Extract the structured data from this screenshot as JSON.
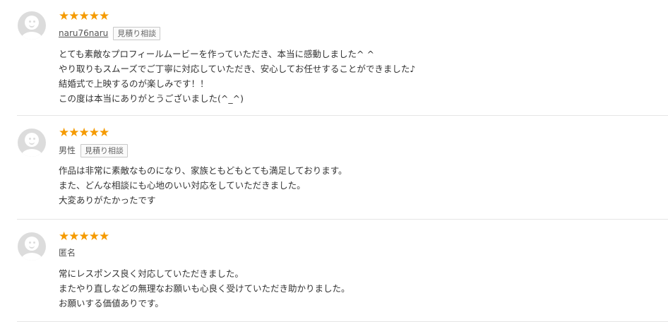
{
  "reviews": [
    {
      "rating": 5,
      "stars": "★★★★★",
      "user": "naru76naru",
      "tag": "見積り相談",
      "lines": [
        "とても素敵なプロフィールムービーを作っていただき、本当に感動しました^ ^",
        "やり取りもスムーズでご丁寧に対応していただき、安心してお任せすることができました♪",
        "結婚式で上映するのが楽しみです！！",
        "この度は本当にありがとうございました(^_^)"
      ]
    },
    {
      "rating": 5,
      "stars": "★★★★★",
      "user": "男性",
      "tag": "見積り相談",
      "lines": [
        "作品は非常に素敵なものになり、家族ともどもとても満足しております。",
        "また、どんな相談にも心地のいい対応をしていただきました。",
        "大変ありがたかったです"
      ]
    },
    {
      "rating": 5,
      "stars": "★★★★★",
      "user": "匿名",
      "lines": [
        "常にレスポンス良く対応していただきました。",
        "またやり直しなどの無理なお願いも心良く受けていただき助かりました。",
        "お願いする価値ありです。"
      ]
    }
  ],
  "icons": {
    "avatar": "default-user-avatar-icon",
    "star": "star-icon"
  },
  "colors": {
    "star": "#f59a00",
    "avatar_bg": "#dcdcdc",
    "divider": "#e5e5e5"
  }
}
